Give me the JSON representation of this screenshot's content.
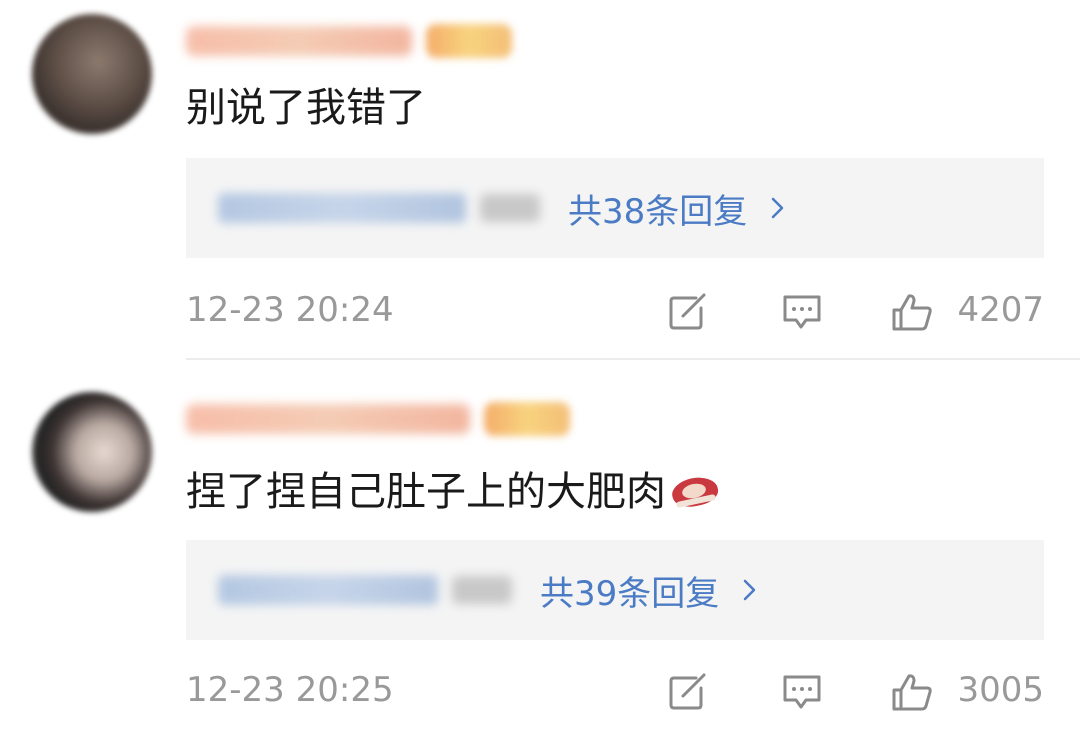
{
  "comments": [
    {
      "text": "别说了我错了",
      "replies_label": "共38条回复",
      "time": "12-23 20:24",
      "likes": "4207"
    },
    {
      "text": "捏了捏自己肚子上的大肥肉",
      "replies_label": "共39条回复",
      "time": "12-23 20:25",
      "likes": "3005"
    }
  ],
  "colors": {
    "reply_link": "#4a7bc4",
    "meta_gray": "#999999",
    "reply_bg": "#f4f4f4"
  },
  "icons": [
    "share-icon",
    "comment-icon",
    "like-icon",
    "chevron-right-icon",
    "meat-emoji"
  ]
}
